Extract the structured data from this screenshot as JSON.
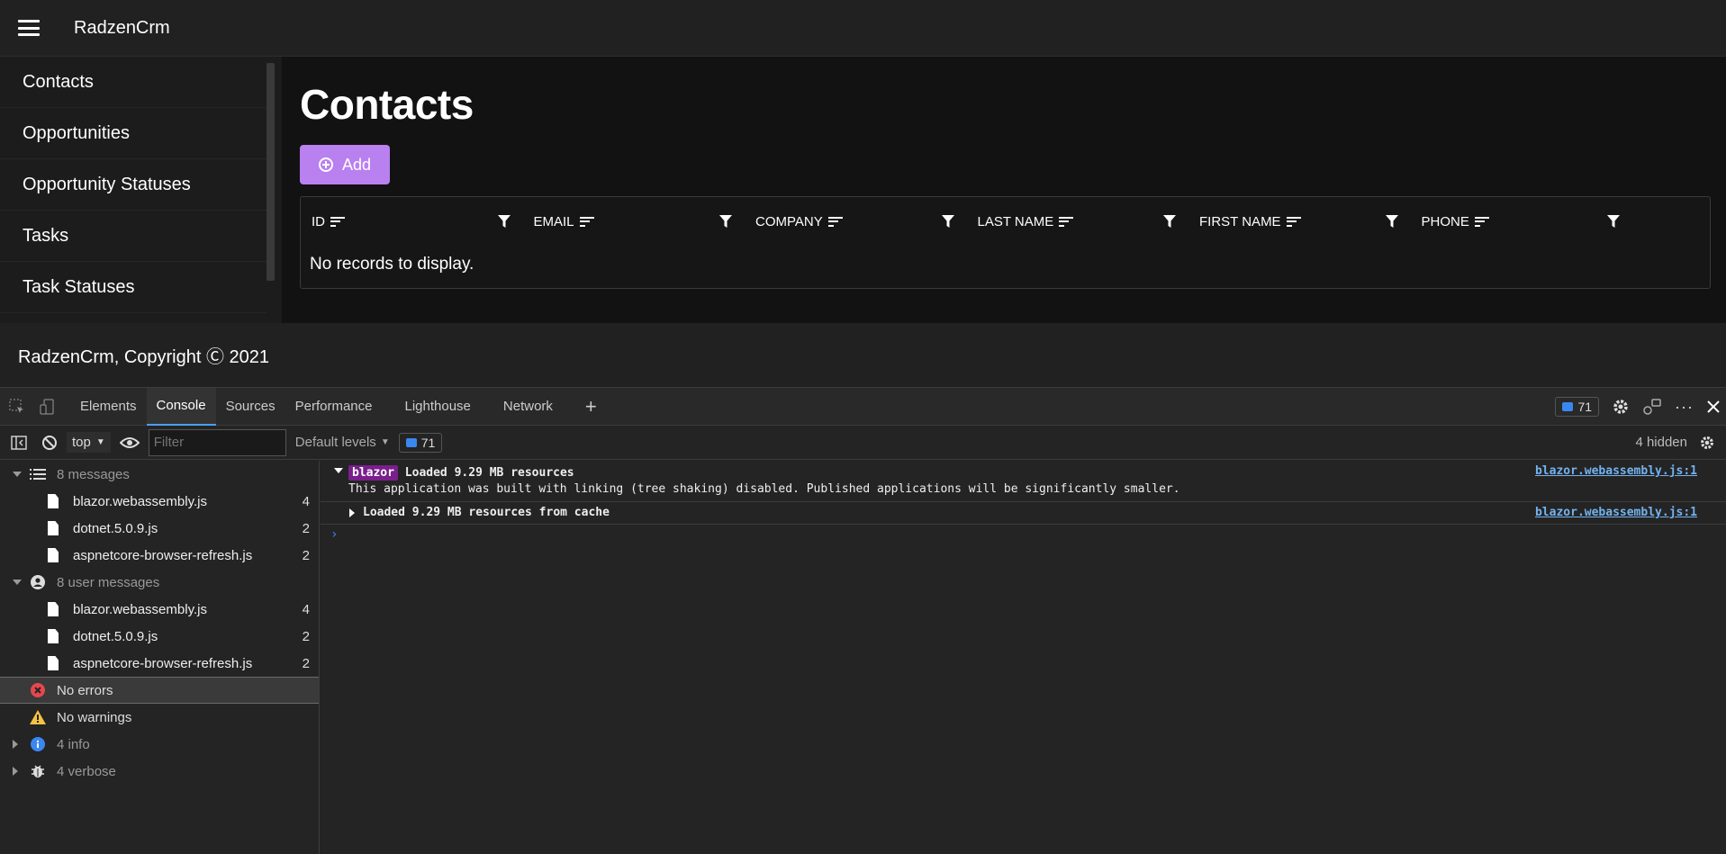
{
  "app": {
    "brand": "RadzenCrm",
    "footer": "RadzenCrm, Copyright Ⓒ 2021",
    "nav": [
      "Contacts",
      "Opportunities",
      "Opportunity Statuses",
      "Tasks",
      "Task Statuses"
    ],
    "page_title": "Contacts",
    "add_label": "Add",
    "accent": "#b980f0",
    "columns": [
      "ID",
      "EMAIL",
      "COMPANY",
      "LAST NAME",
      "FIRST NAME",
      "PHONE"
    ],
    "empty_message": "No records to display."
  },
  "devtools": {
    "tabs": [
      "Elements",
      "Console",
      "Sources",
      "Performance",
      "Lighthouse",
      "Network"
    ],
    "active_tab": "Console",
    "issues_count": "71",
    "context": "top",
    "filter_placeholder": "Filter",
    "levels": "Default levels",
    "hidden": "4 hidden",
    "sidebar": {
      "messages": {
        "label": "8 messages",
        "files": [
          {
            "name": "blazor.webassembly.js",
            "count": "4"
          },
          {
            "name": "dotnet.5.0.9.js",
            "count": "2"
          },
          {
            "name": "aspnetcore-browser-refresh.js",
            "count": "2"
          }
        ]
      },
      "user_messages": {
        "label": "8 user messages",
        "files": [
          {
            "name": "blazor.webassembly.js",
            "count": "4"
          },
          {
            "name": "dotnet.5.0.9.js",
            "count": "2"
          },
          {
            "name": "aspnetcore-browser-refresh.js",
            "count": "2"
          }
        ]
      },
      "errors": "No errors",
      "warnings": "No warnings",
      "info": "4 info",
      "verbose": "4 verbose"
    },
    "logs": [
      {
        "tag": "blazor",
        "title": "Loaded 9.29 MB resources",
        "detail": "This application was built with linking (tree shaking) disabled. Published applications will be significantly smaller.",
        "source": "blazor.webassembly.js:1"
      },
      {
        "title": "Loaded 9.29 MB resources from cache",
        "source": "blazor.webassembly.js:1"
      }
    ],
    "prompt": "›"
  }
}
